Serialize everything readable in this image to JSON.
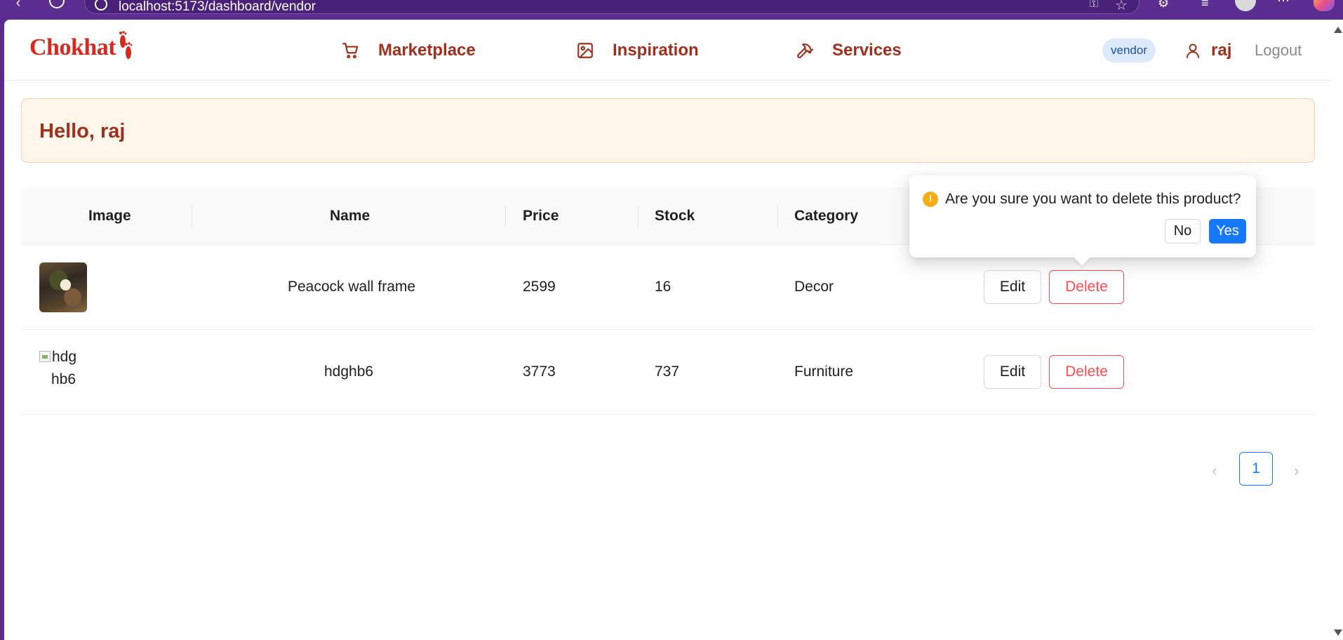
{
  "browser": {
    "url": "localhost:5173/dashboard/vendor"
  },
  "header": {
    "logo_text": "Chokhat",
    "nav": [
      {
        "label": "Marketplace",
        "icon": "cart-icon"
      },
      {
        "label": "Inspiration",
        "icon": "image-icon"
      },
      {
        "label": "Services",
        "icon": "hammer-icon"
      }
    ],
    "role_badge": "vendor",
    "username": "raj",
    "logout_label": "Logout"
  },
  "greeting": "Hello, raj",
  "table": {
    "columns": [
      "Image",
      "Name",
      "Price",
      "Stock",
      "Category"
    ],
    "rows": [
      {
        "image_alt": "",
        "name": "Peacock wall frame",
        "price": "2599",
        "stock": "16",
        "category": "Decor",
        "edit_label": "Edit",
        "delete_label": "Delete"
      },
      {
        "image_alt": "hdghb6",
        "image_alt_line1": "hdg",
        "image_alt_line2": "hb6",
        "name": "hdghb6",
        "price": "3773",
        "stock": "737",
        "category": "Furniture",
        "edit_label": "Edit",
        "delete_label": "Delete"
      }
    ]
  },
  "pagination": {
    "current_page": "1",
    "prev_icon": "chevron-left-icon",
    "next_icon": "chevron-right-icon"
  },
  "popconfirm": {
    "icon": "exclamation-circle-icon",
    "message": "Are you sure you want to delete this product?",
    "no_label": "No",
    "yes_label": "Yes"
  },
  "colors": {
    "brand_red": "#d42a1f",
    "nav_text": "#a0301b",
    "greeting_bg": "#fff6ec",
    "primary_blue": "#1677ff",
    "danger": "#ff4d4f",
    "warning": "#faad14",
    "browser_chrome": "#5b2d91"
  }
}
